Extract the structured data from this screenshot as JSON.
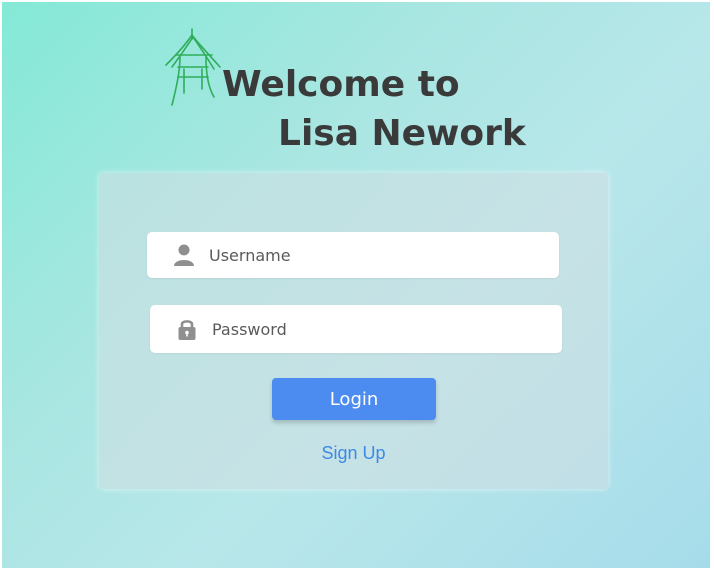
{
  "header": {
    "title_line1": "Welcome to",
    "title_line2": "Lisa Nework",
    "logo_icon": "pagoda-logo-icon"
  },
  "login_form": {
    "username": {
      "icon": "user-icon",
      "placeholder": "Username",
      "value": ""
    },
    "password": {
      "icon": "lock-icon",
      "placeholder": "Password",
      "value": ""
    },
    "login_label": "Login",
    "signup_label": "Sign Up"
  },
  "colors": {
    "background_start": "#84e9d6",
    "background_end": "#a6dcea",
    "title_text": "#3a3a3a",
    "button": "#4c8bef",
    "link": "#3d8ae6",
    "logo": "#2fae5a"
  }
}
